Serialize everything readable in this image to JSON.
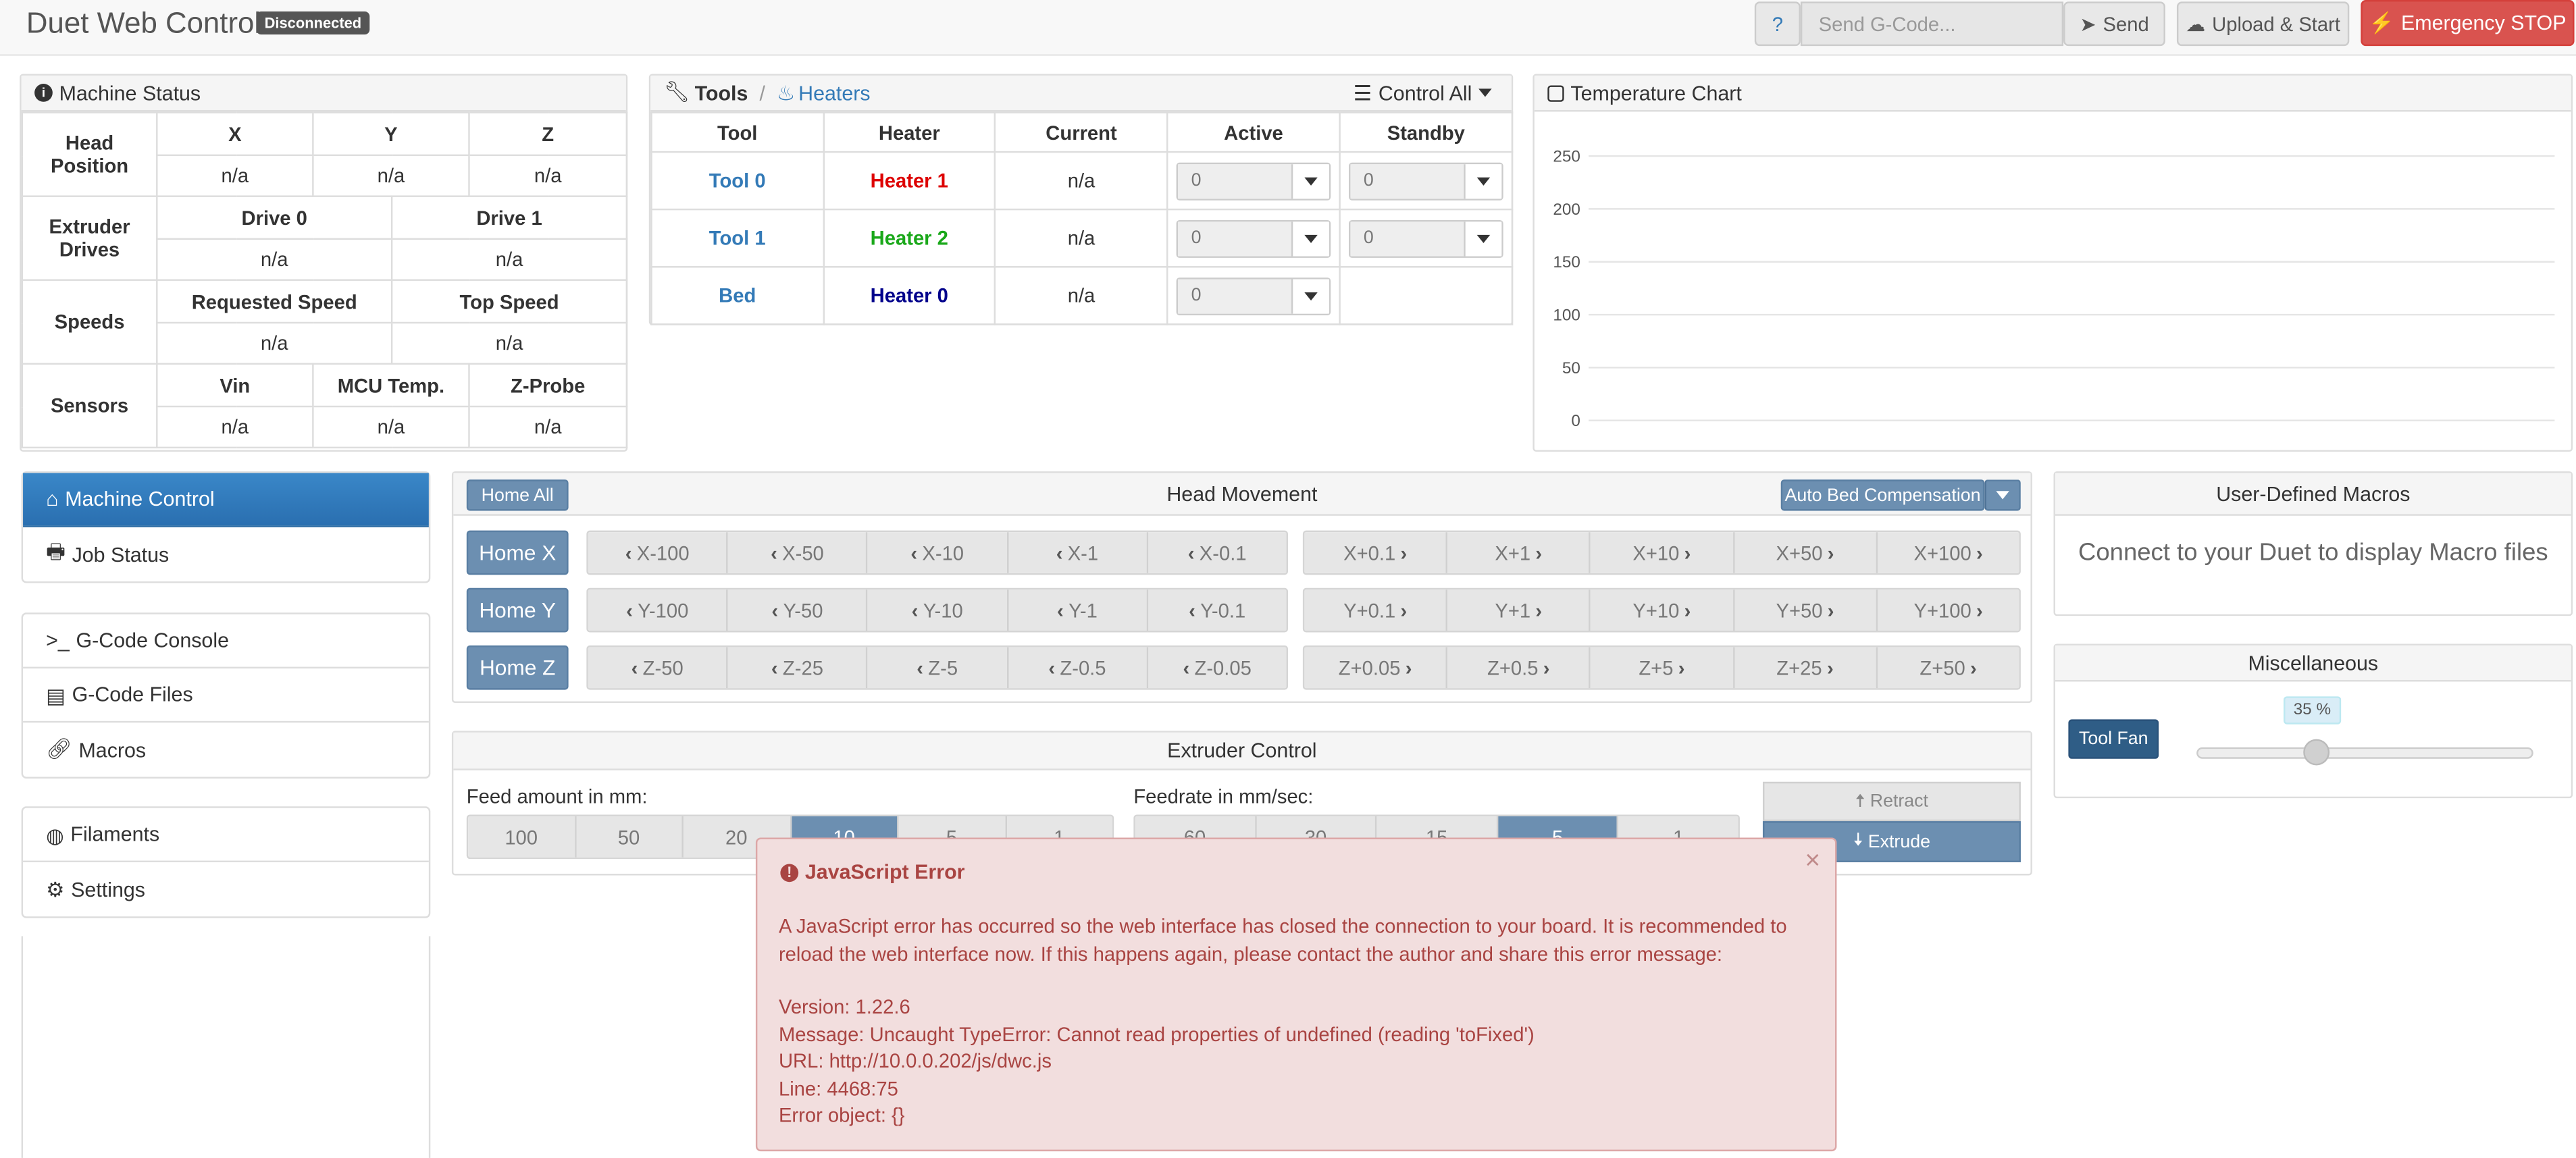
{
  "navbar": {
    "brand": "Duet Web Control",
    "status_badge": "Disconnected",
    "help_label": "?",
    "gcode_placeholder": "Send G-Code...",
    "send_label": "Send",
    "upload_label": "Upload & Start",
    "estop_label": "Emergency STOP"
  },
  "machine_status": {
    "title": "Machine Status",
    "head_position": {
      "label": "Head Position",
      "cols": [
        "X",
        "Y",
        "Z"
      ],
      "values": [
        "n/a",
        "n/a",
        "n/a"
      ]
    },
    "extruder_drives": {
      "label": "Extruder Drives",
      "cols": [
        "Drive 0",
        "Drive 1"
      ],
      "values": [
        "n/a",
        "n/a"
      ]
    },
    "speeds": {
      "label": "Speeds",
      "cols": [
        "Requested Speed",
        "Top Speed"
      ],
      "values": [
        "n/a",
        "n/a"
      ]
    },
    "sensors": {
      "label": "Sensors",
      "cols": [
        "Vin",
        "MCU Temp.",
        "Z-Probe"
      ],
      "values": [
        "n/a",
        "n/a",
        "n/a"
      ]
    }
  },
  "tools_panel": {
    "tools_label": "Tools",
    "separator": "/",
    "heaters_label": "Heaters",
    "control_all_label": "Control All",
    "headers": [
      "Tool",
      "Heater",
      "Current",
      "Active",
      "Standby"
    ],
    "rows": [
      {
        "tool": "Tool 0",
        "heater": "Heater 1",
        "current": "n/a",
        "active": "0",
        "standby": "0"
      },
      {
        "tool": "Tool 1",
        "heater": "Heater 2",
        "current": "n/a",
        "active": "0",
        "standby": "0"
      },
      {
        "tool": "Bed",
        "heater": "Heater 0",
        "current": "n/a",
        "active": "0"
      }
    ]
  },
  "temp_chart": {
    "title": "Temperature Chart",
    "y_ticks": [
      "250",
      "200",
      "150",
      "100",
      "50",
      "0"
    ]
  },
  "chart_data": {
    "type": "line",
    "title": "Temperature Chart",
    "ylim": [
      0,
      250
    ],
    "y_ticks": [
      0,
      50,
      100,
      150,
      200,
      250
    ],
    "series": [],
    "grid": true
  },
  "sidebar": {
    "group1": [
      {
        "label": "Machine Control",
        "icon": "home-icon"
      },
      {
        "label": "Job Status",
        "icon": "print-icon"
      }
    ],
    "group2": [
      {
        "label": "G-Code Console",
        "icon": "console-icon"
      },
      {
        "label": "G-Code Files",
        "icon": "hdd-icon"
      },
      {
        "label": "Macros",
        "icon": "link-icon"
      }
    ],
    "group3": [
      {
        "label": "Filaments",
        "icon": "globe-icon"
      },
      {
        "label": "Settings",
        "icon": "gear-icon"
      }
    ]
  },
  "head_movement": {
    "title": "Head Movement",
    "home_all": "Home All",
    "abc_label": "Auto Bed Compensation",
    "rows": [
      {
        "home": "Home X",
        "neg": [
          "X-100",
          "X-50",
          "X-10",
          "X-1",
          "X-0.1"
        ],
        "pos": [
          "X+0.1",
          "X+1",
          "X+10",
          "X+50",
          "X+100"
        ]
      },
      {
        "home": "Home Y",
        "neg": [
          "Y-100",
          "Y-50",
          "Y-10",
          "Y-1",
          "Y-0.1"
        ],
        "pos": [
          "Y+0.1",
          "Y+1",
          "Y+10",
          "Y+50",
          "Y+100"
        ]
      },
      {
        "home": "Home Z",
        "neg": [
          "Z-50",
          "Z-25",
          "Z-5",
          "Z-0.5",
          "Z-0.05"
        ],
        "pos": [
          "Z+0.05",
          "Z+0.5",
          "Z+5",
          "Z+25",
          "Z+50"
        ]
      }
    ]
  },
  "extruder": {
    "title": "Extruder Control",
    "feed_label": "Feed amount in mm:",
    "feed_options": [
      "100",
      "50",
      "20",
      "10",
      "5",
      "1"
    ],
    "feed_selected": "10",
    "rate_label": "Feedrate in mm/sec:",
    "rate_options": [
      "60",
      "30",
      "15",
      "5",
      "1"
    ],
    "rate_selected": "5",
    "retract_label": "Retract",
    "extrude_label": "Extrude"
  },
  "macros": {
    "title": "User-Defined Macros",
    "message": "Connect to your Duet to display Macro files"
  },
  "misc": {
    "title": "Miscellaneous",
    "fan_label": "Tool Fan",
    "fan_value_label": "35 %",
    "fan_value": 0.35
  },
  "error": {
    "title": "JavaScript Error",
    "close": "×",
    "message": "A JavaScript error has occurred so the web interface has closed the connection to your board. It is recommended to reload the web interface now. If this happens again, please contact the author and share this error message:",
    "version": "Version: 1.22.6",
    "detail": "Message: Uncaught TypeError: Cannot read properties of undefined (reading 'toFixed')",
    "url": "URL: http://10.0.0.202/js/dwc.js",
    "line": "Line: 4468:75",
    "object": "Error object: {}"
  },
  "colors": {
    "primary": "#337ab7",
    "danger": "#d9534f",
    "heater1": "#dd0000",
    "heater2": "#1aa81a",
    "heater0": "#00008b",
    "alert_bg": "#f2dede",
    "alert_text": "#a94442"
  }
}
